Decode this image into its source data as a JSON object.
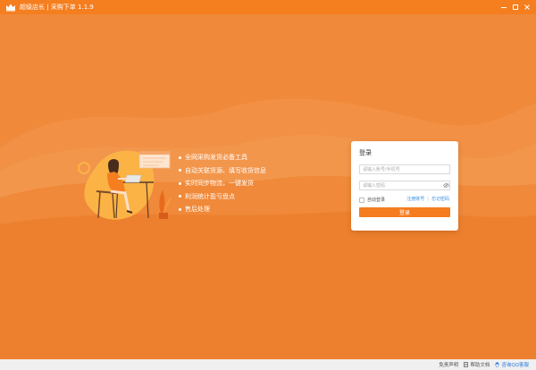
{
  "window": {
    "title": "超级店长 | 采购下单 1.1.9",
    "controls": [
      "minimize",
      "maximize",
      "close"
    ]
  },
  "features": [
    "全网采购发货必备工具",
    "自动关联货源、填写收货信息",
    "实时同步物流，一键发货",
    "利润统计盈亏盘点",
    "售后处理"
  ],
  "login": {
    "heading": "登录",
    "account_placeholder": "请输入账号/手机号",
    "password_placeholder": "请输入密码",
    "remember_label": "自动登录",
    "register_link": "注册账号",
    "forgot_link": "忘记密码",
    "submit_label": "登录"
  },
  "statusbar": {
    "disclaimer": "免责声明",
    "help": "帮助文档",
    "qq_service": "咨询QQ客服"
  },
  "colors": {
    "accent": "#f57e1f",
    "background": "#f08a3a",
    "link": "#3a8ee6"
  },
  "icons": {
    "logo": "crown-icon",
    "password_toggle": "eye-icon",
    "help": "doc-icon",
    "qq": "qq-penguin-icon"
  }
}
